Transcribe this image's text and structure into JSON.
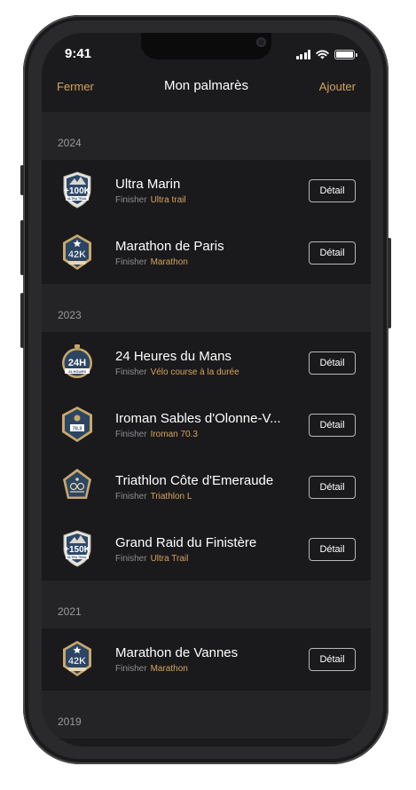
{
  "status_bar": {
    "time": "9:41"
  },
  "nav": {
    "close_label": "Fermer",
    "title": "Mon palmarès",
    "add_label": "Ajouter"
  },
  "colors": {
    "accent": "#d7a35c",
    "background": "#1b1b1d",
    "section": "#242426"
  },
  "sections": [
    {
      "year": "2024",
      "items": [
        {
          "name": "Ultra Marin",
          "status": "Finisher",
          "category": "Ultra trail",
          "badge_text": "+100K",
          "badge_sub": "ULTRA TRAIL",
          "badge_icon": "ultra-trail-100k-badge-icon",
          "button": "Détail"
        },
        {
          "name": "Marathon de Paris",
          "status": "Finisher",
          "category": "Marathon",
          "badge_text": "42K",
          "badge_sub": "MARATHON",
          "badge_icon": "marathon-42k-badge-icon",
          "button": "Détail"
        }
      ]
    },
    {
      "year": "2023",
      "items": [
        {
          "name": "24 Heures du Mans",
          "status": "Finisher",
          "category": "Vélo course à la durée",
          "badge_text": "24H",
          "badge_sub": "24 HOURS",
          "badge_icon": "24h-badge-icon",
          "button": "Détail"
        },
        {
          "name": "Iroman Sables d'Olonne-V...",
          "status": "Finisher",
          "category": "Iroman 70.3",
          "badge_text": "70.3",
          "badge_sub": "IRONMAN 70.3",
          "badge_icon": "ironman-70-3-badge-icon",
          "button": "Détail"
        },
        {
          "name": "Triathlon Côte d'Emeraude",
          "status": "Finisher",
          "category": "Triathlon L",
          "badge_text": "",
          "badge_sub": "TRIATHLON",
          "badge_icon": "triathlon-badge-icon",
          "button": "Détail"
        },
        {
          "name": "Grand Raid du Finistère",
          "status": "Finisher",
          "category": "Ultra Trail",
          "badge_text": "+150K",
          "badge_sub": "ULTRA TRAIL",
          "badge_icon": "ultra-trail-150k-badge-icon",
          "button": "Détail"
        }
      ]
    },
    {
      "year": "2021",
      "items": [
        {
          "name": "Marathon de Vannes",
          "status": "Finisher",
          "category": "Marathon",
          "badge_text": "42K",
          "badge_sub": "MARATHON",
          "badge_icon": "marathon-42k-badge-icon",
          "button": "Détail"
        }
      ]
    },
    {
      "year": "2019",
      "items": []
    }
  ]
}
